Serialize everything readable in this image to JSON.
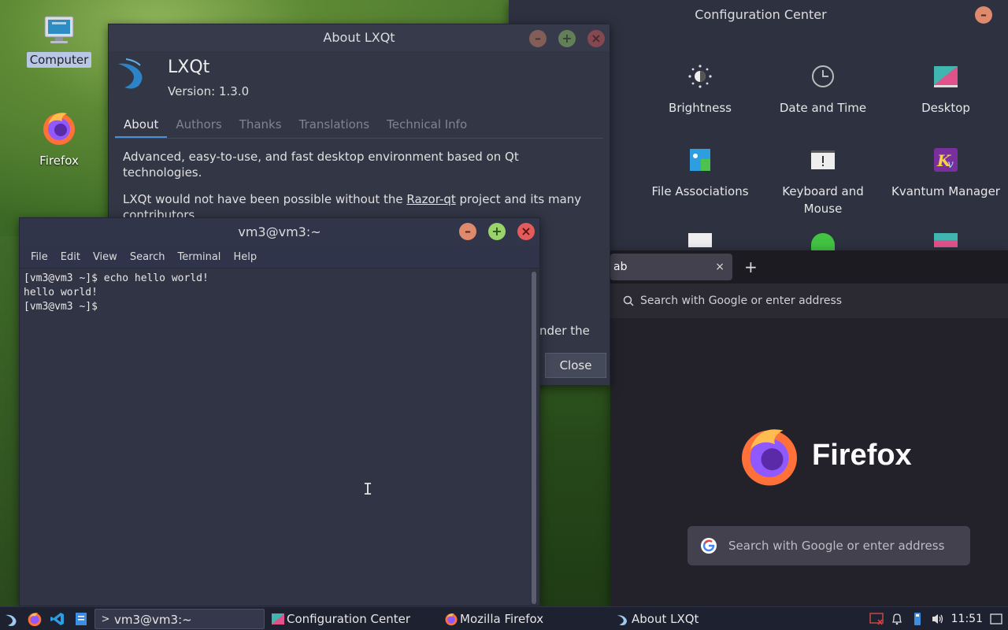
{
  "desktop": {
    "icons": [
      {
        "label": "Computer",
        "icon": "computer-icon"
      },
      {
        "label": "Firefox",
        "icon": "firefox-icon"
      }
    ]
  },
  "config_center": {
    "title": "Configuration Center",
    "items": [
      {
        "label": "Brightness",
        "icon": "brightness-icon"
      },
      {
        "label": "Date and Time",
        "icon": "clock-icon"
      },
      {
        "label": "Desktop",
        "icon": "desktop-icon"
      },
      {
        "label": "File Associations",
        "icon": "file-associations-icon"
      },
      {
        "label": "Keyboard and Mouse",
        "icon": "keyboard-icon"
      },
      {
        "label": "Kvantum Manager",
        "icon": "kvantum-icon"
      }
    ]
  },
  "firefox": {
    "tab_label": "ab",
    "tab_close": "×",
    "new_tab": "+",
    "url_placeholder": "Search with Google or enter address",
    "brand": "Firefox",
    "search_placeholder": "Search with Google or enter address"
  },
  "about": {
    "title": "About LXQt",
    "name": "LXQt",
    "version": "Version: 1.3.0",
    "tabs": [
      "About",
      "Authors",
      "Thanks",
      "Translations",
      "Technical Info"
    ],
    "para1": "Advanced, easy-to-use, and fast desktop environment based on Qt technologies.",
    "para2_pre": "LXQt would not have been possible without the ",
    "para2_link": "Razor-qt",
    "para2_post": " project and its many contributors.",
    "tail_text": "nder the",
    "close_label": "Close"
  },
  "terminal": {
    "title": "vm3@vm3:~",
    "menu": [
      "File",
      "Edit",
      "View",
      "Search",
      "Terminal",
      "Help"
    ],
    "lines": [
      "[vm3@vm3 ~]$ echo hello world!",
      "hello world!",
      "[vm3@vm3 ~]$"
    ]
  },
  "taskbar": {
    "tasks": [
      {
        "label": "vm3@vm3:~",
        "icon": "terminal-icon",
        "active": true
      },
      {
        "label": "Configuration Center",
        "icon": "config-icon",
        "active": false
      },
      {
        "label": "Mozilla Firefox",
        "icon": "firefox-icon",
        "active": false
      },
      {
        "label": "About LXQt",
        "icon": "lxqt-icon",
        "active": false
      }
    ],
    "clock": "11:51"
  },
  "colors": {
    "accent": "#4a8fd8",
    "window_bg": "#323645",
    "taskbar_bg": "#1e2130"
  }
}
